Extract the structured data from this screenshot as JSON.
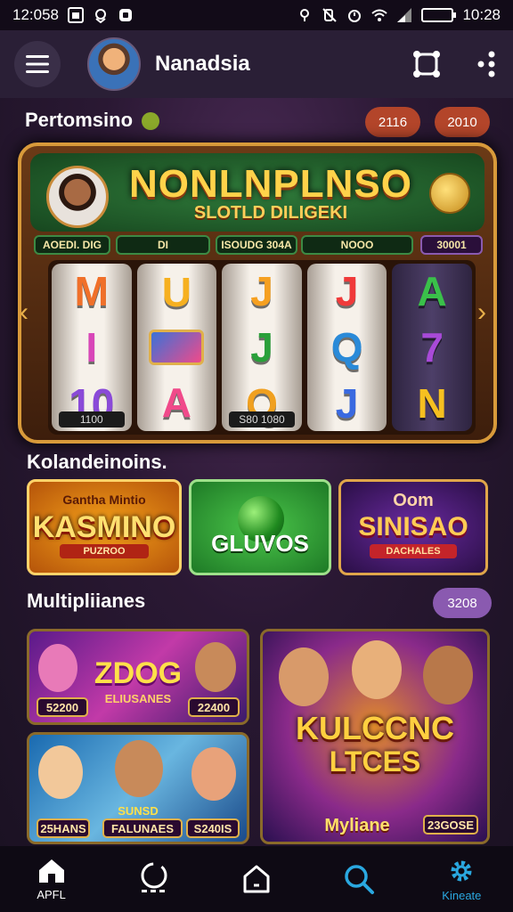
{
  "status_bar": {
    "time_left": "12:058",
    "time_right": "10:28"
  },
  "header": {
    "title": "Nanadsia"
  },
  "featured": {
    "section_title": "Pertomsino",
    "pill_a": "2116",
    "pill_b": "2010",
    "slot_title": "NONLNPLNSO",
    "slot_subtitle": "SLOTLD DILIGEKI",
    "info": [
      "AOEDI. DIG",
      "DI",
      "ISOUDG 304A",
      "NOOO",
      "30001"
    ],
    "reels": [
      {
        "symbols": [
          "M",
          "I",
          "10"
        ],
        "colors": [
          "#f0702a",
          "#d846b8",
          "#8a4ad8"
        ]
      },
      {
        "symbols": [
          "U",
          "",
          "A"
        ],
        "colors": [
          "#f6b020",
          "#3a72d8",
          "#f04a8a"
        ]
      },
      {
        "symbols": [
          "J",
          "J",
          "Q"
        ],
        "colors": [
          "#f6a020",
          "#2aa03a",
          "#f0a020"
        ]
      },
      {
        "symbols": [
          "J",
          "Q",
          "J"
        ],
        "colors": [
          "#f03a3a",
          "#2a8ad8",
          "#3a6ae0"
        ]
      },
      {
        "symbols": [
          "A",
          "7",
          "N"
        ],
        "colors": [
          "#3ac04a",
          "#a84ad8",
          "#f6c020"
        ]
      }
    ],
    "reel_labels": [
      "1100",
      "S80 1080"
    ]
  },
  "recommended": {
    "section_title": "Kolandeinoins.",
    "cards": [
      {
        "top": "Gantha Mintio",
        "big": "KASMINO",
        "sub": "PUZROO"
      },
      {
        "top": "",
        "big": "GLUVOS",
        "sub": ""
      },
      {
        "top": "Oom",
        "big": "SINISAO",
        "sub": "DACHALES"
      }
    ]
  },
  "multi": {
    "section_title": "Multipliianes",
    "pill": "3208",
    "tile1": {
      "title": "ZDOG",
      "sub": "ELIUSANES",
      "tag_left": "52200",
      "tag_right": "22400"
    },
    "tile2": {
      "title": "SUNSD",
      "sub": "FALUNAES",
      "tag_left": "25HANS",
      "tag_right": "S240IS"
    },
    "tile3": {
      "title": "KULCCNC",
      "title2": "LTCES",
      "bottom": "Myliane",
      "tag": "23GOSE"
    }
  },
  "nav": [
    {
      "label": "APFL",
      "icon": "home-icon"
    },
    {
      "label": "",
      "icon": "refresh-icon"
    },
    {
      "label": "",
      "icon": "house-outline-icon"
    },
    {
      "label": "",
      "icon": "search-icon"
    },
    {
      "label": "Kineate",
      "icon": "gear-icon"
    }
  ],
  "colors": {
    "accent": "#2aa8e0",
    "pill": "#b3452a",
    "pill_purple": "#8a5ab0"
  }
}
